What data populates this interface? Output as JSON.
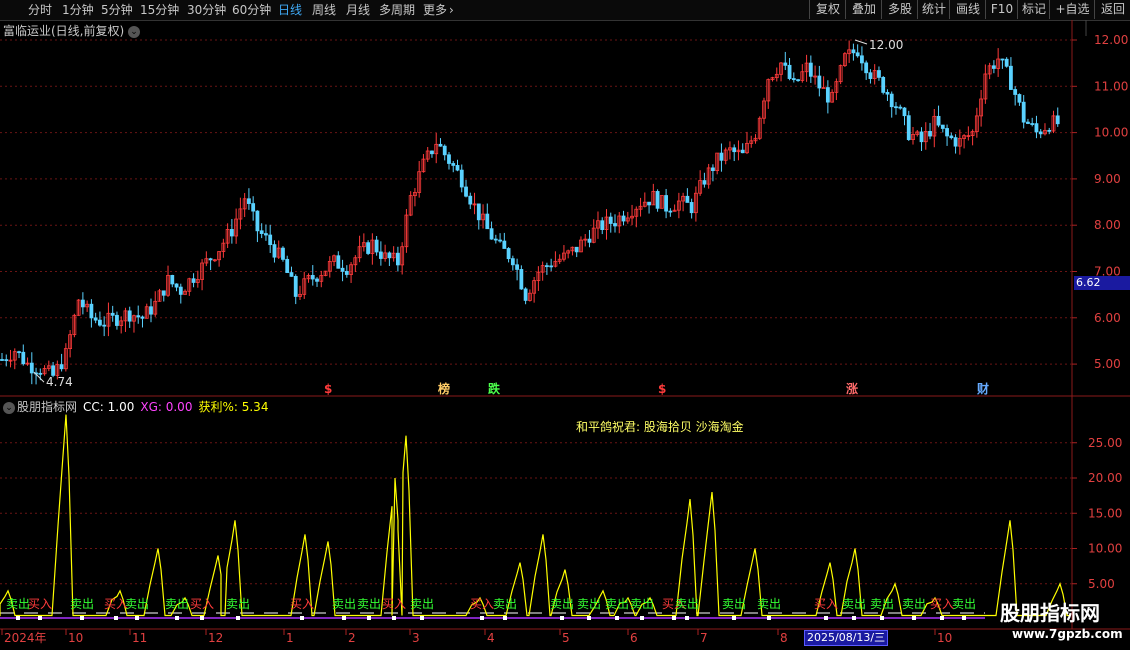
{
  "toolbar": {
    "periods": [
      "分时",
      "1分钟",
      "5分钟",
      "15分钟",
      "30分钟",
      "60分钟",
      "日线",
      "周线",
      "月线",
      "多周期",
      "更多"
    ],
    "active": "日线",
    "more_arrow": "chevron-right-icon",
    "right": [
      "复权",
      "叠加",
      "多股",
      "统计",
      "画线",
      "F10",
      "标记",
      "+自选",
      "返回"
    ]
  },
  "main_chart": {
    "title": "富临运业(日线,前复权)",
    "price_ticks": [
      "12.00",
      "11.00",
      "10.00",
      "9.00",
      "8.00",
      "7.00",
      "6.00",
      "5.00"
    ],
    "current_price": "6.62",
    "high_label": "12.00",
    "low_label": "4.74",
    "markers": [
      {
        "text": "$",
        "color": "#ff3b3b"
      },
      {
        "text": "榜",
        "color": "#ffcc66"
      },
      {
        "text": "跌",
        "color": "#4cff4c"
      },
      {
        "text": "$",
        "color": "#ff3b3b"
      },
      {
        "text": "涨",
        "color": "#ff6a6a"
      },
      {
        "text": "财",
        "color": "#66aaff"
      }
    ]
  },
  "indicator": {
    "name": "股朋指标网",
    "cc_label": "CC: 1.00",
    "xg_label": "XG: 0.00",
    "profit_label": "获利%: 5.34",
    "annotation": "和平鸽祝君:  股海拾贝  沙海淘金",
    "y_ticks": [
      "25.00",
      "20.00",
      "15.00",
      "10.00",
      "5.00"
    ]
  },
  "x_axis": {
    "labels": [
      "2024年",
      "10",
      "11",
      "12",
      "1",
      "2",
      "3",
      "4",
      "5",
      "6",
      "7",
      "8",
      "2025/08/13/三",
      "10"
    ]
  },
  "watermark": {
    "text": "股朋指标网",
    "url": "www.7gpzb.com"
  },
  "chart_data": {
    "type": "line",
    "title": "",
    "ylim": [
      4.5,
      12.3
    ],
    "series": [
      {
        "name": "",
        "values": [
          5.1,
          5.3,
          5.0,
          4.9,
          4.74,
          5.2,
          6.4,
          6.0,
          5.9,
          6.0,
          6.1,
          6.0,
          6.3,
          6.8,
          6.6,
          6.9,
          7.2,
          7.5,
          7.9,
          8.6,
          7.9,
          7.6,
          7.2,
          6.5,
          6.8,
          7.0,
          7.2,
          7.1,
          7.4,
          7.6,
          7.3,
          7.2,
          8.6,
          9.3,
          9.8,
          9.4,
          9.0,
          8.4,
          7.9,
          7.5,
          7.3,
          6.5,
          7.0,
          7.2,
          7.3,
          7.5,
          7.8,
          8.0,
          8.1,
          8.3,
          8.5,
          8.6,
          8.4,
          8.5,
          8.4,
          9.0,
          9.4,
          9.6,
          9.5,
          10.0,
          11.2,
          11.5,
          11.0,
          11.4,
          11.0,
          10.7,
          11.6,
          11.8,
          11.3,
          11.0,
          10.6,
          10.0,
          9.8,
          10.2,
          9.9,
          9.8,
          10.0,
          11.3,
          11.6,
          11.1,
          10.3,
          10.0,
          10.2
        ]
      }
    ]
  },
  "colors": {
    "up": "#ff3b3b",
    "down": "#5ad2ff",
    "profit_line": "#ffff00",
    "buy": "#ff3b3b",
    "sell": "#33ff33",
    "grid": "#5a1010"
  }
}
